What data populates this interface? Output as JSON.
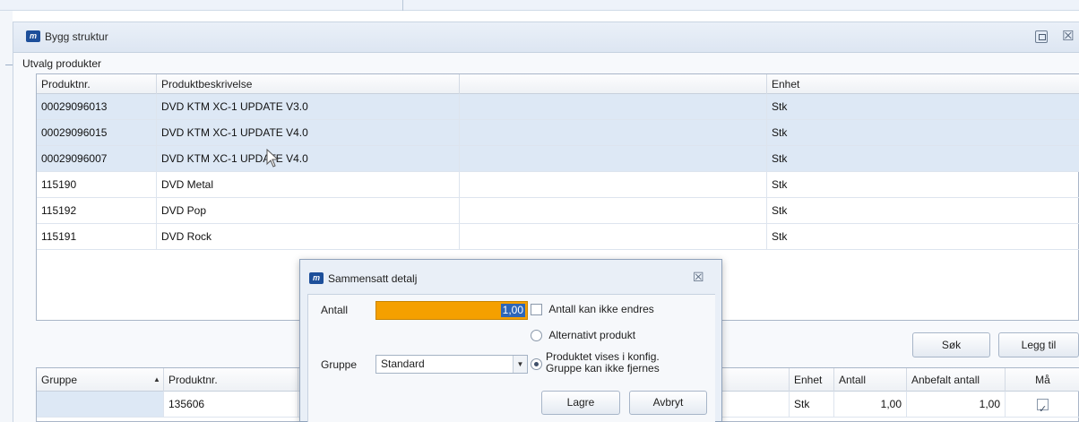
{
  "window": {
    "title": "Bygg struktur"
  },
  "selection": {
    "section_label": "Utvalg produkter",
    "columns": [
      "Produktnr.",
      "Produktbeskrivelse",
      "",
      "Enhet"
    ],
    "rows": [
      {
        "produktnr": "00029096013",
        "beskrivelse": "DVD KTM XC-1 UPDATE V3.0",
        "enhet": "Stk"
      },
      {
        "produktnr": "00029096015",
        "beskrivelse": "DVD KTM XC-1 UPDATE V4.0",
        "enhet": "Stk"
      },
      {
        "produktnr": "00029096007",
        "beskrivelse": "DVD KTM XC-1 UPDATE V4.0",
        "enhet": "Stk"
      },
      {
        "produktnr": "115190",
        "beskrivelse": "DVD Metal",
        "enhet": "Stk"
      },
      {
        "produktnr": "115192",
        "beskrivelse": "DVD Pop",
        "enhet": "Stk"
      },
      {
        "produktnr": "115191",
        "beskrivelse": "DVD Rock",
        "enhet": "Stk"
      }
    ]
  },
  "buttons": {
    "search": "Søk",
    "add": "Legg til"
  },
  "structure": {
    "columns": {
      "gruppe": "Gruppe",
      "produktnr": "Produktnr.",
      "enhet": "Enhet",
      "antall": "Antall",
      "anbefalt": "Anbefalt antall",
      "maa": "Må"
    },
    "row": {
      "gruppe": "",
      "produktnr": "135606",
      "enhet": "Stk",
      "antall": "1,00",
      "anbefalt": "1,00",
      "maa_checked": true
    }
  },
  "dialog": {
    "title": "Sammensatt detalj",
    "antall_label": "Antall",
    "antall_value": "1,00",
    "gruppe_label": "Gruppe",
    "gruppe_value": "Standard",
    "check_antall_fixed": "Antall kan ikke endres",
    "radio_alternativ": "Alternativt produkt",
    "radio_konfig_line1": "Produktet vises i konfig.",
    "radio_konfig_line2": "Gruppe kan ikke fjernes",
    "save": "Lagre",
    "cancel": "Avbryt"
  },
  "icons": {
    "app_logo_text": "m",
    "restore": "restore-icon",
    "close": "close-icon"
  },
  "colors": {
    "selected_row": "#dde8f5",
    "highlight_input": "#f5a000",
    "selection_text_bg": "#2d66b8"
  }
}
